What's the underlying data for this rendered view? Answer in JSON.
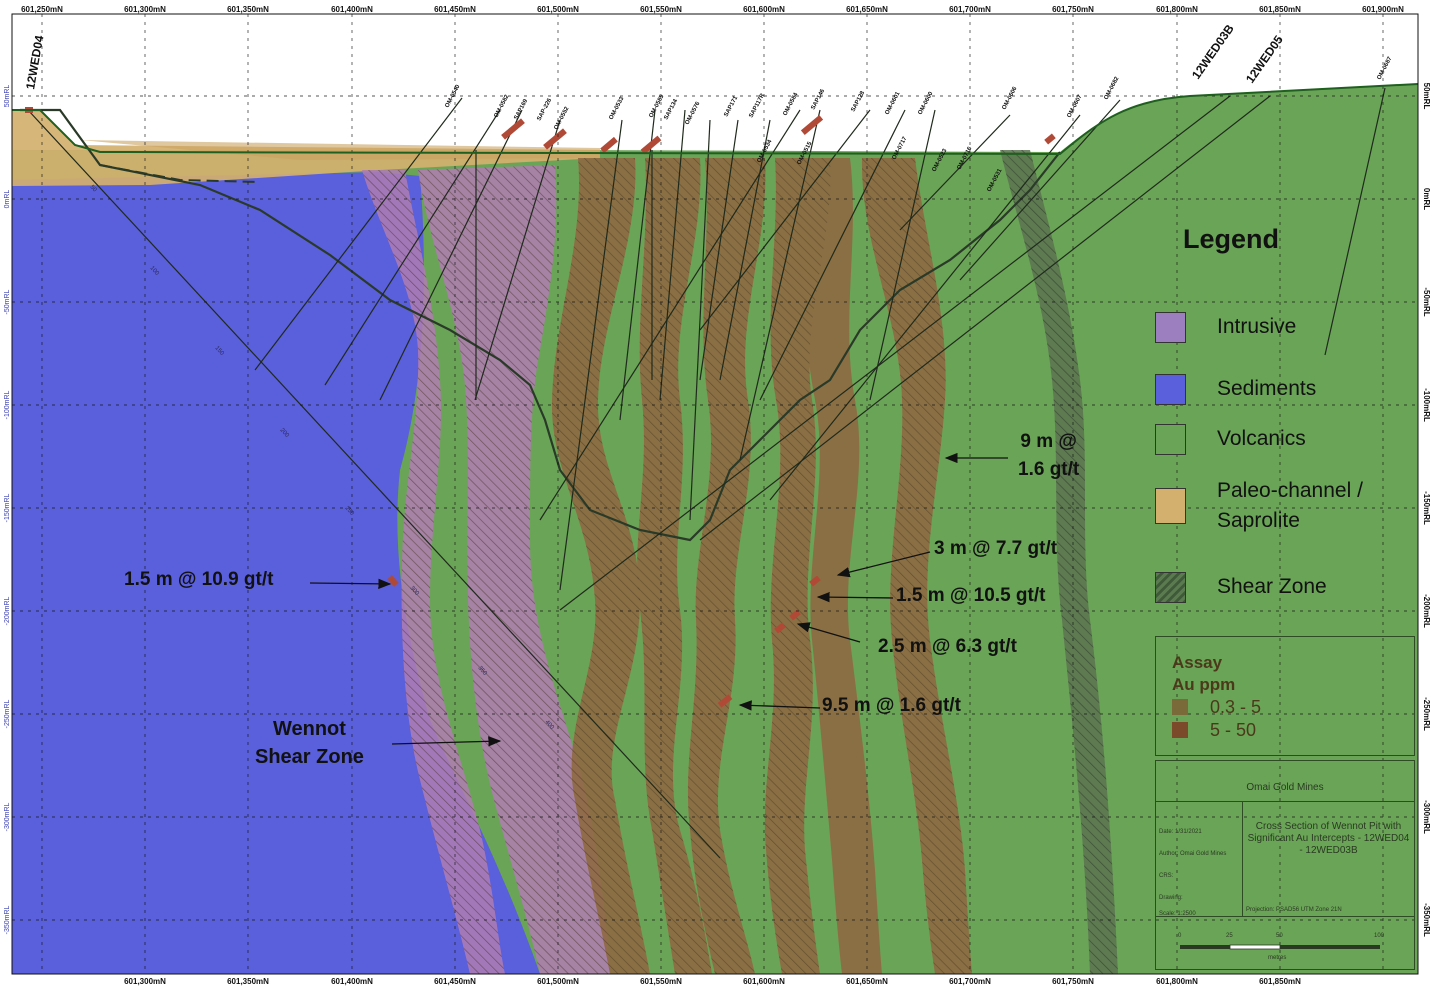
{
  "northing_labels": [
    "601,250mN",
    "601,300mN",
    "601,350mN",
    "601,400mN",
    "601,450mN",
    "601,500mN",
    "601,550mN",
    "601,600mN",
    "601,650mN",
    "601,700mN",
    "601,750mN",
    "601,800mN",
    "601,850mN",
    "601,900mN"
  ],
  "northing_bottom_labels": [
    "601,300mN",
    "601,350mN",
    "601,400mN",
    "601,450mN",
    "601,500mN",
    "601,550mN",
    "601,600mN",
    "601,650mN",
    "601,700mN",
    "601,750mN",
    "601,800mN",
    "601,850mN"
  ],
  "rl_labels": [
    "50mRL",
    "0mRL",
    "-50mRL",
    "-100mRL",
    "-150mRL",
    "-200mRL",
    "-250mRL",
    "-300mRL",
    "-350mRL"
  ],
  "holes": {
    "wed04": "12WED04",
    "wed03b": "12WED03B",
    "wed05": "12WED05",
    "minor": [
      "OM-0540",
      "OM-0582",
      "SAP169",
      "SAP-226",
      "OM-0552",
      "OM-0533",
      "OM-0585",
      "SAP134",
      "OM-0576",
      "SAP171",
      "SAP117R",
      "OM-0584",
      "SAP146",
      "SAP128",
      "OM-0601",
      "OM-0600",
      "OM-0606",
      "OM-0607",
      "OM-0682",
      "OM-0687",
      "OM-0534",
      "OM-0515",
      "OM-0717",
      "OM-0523",
      "OM-0716",
      "OM-0531"
    ]
  },
  "depth_marks": [
    "50",
    "100",
    "150",
    "200",
    "250",
    "300",
    "350",
    "400"
  ],
  "legend": {
    "title": "Legend",
    "intrusive": "Intrusive",
    "sediments": "Sediments",
    "volcanics": "Volcanics",
    "paleo_line1": "Paleo-channel /",
    "paleo_line2": "Saprolite",
    "shear": "Shear Zone",
    "colors": {
      "intrusive": "#9b7fbf",
      "sediments": "#5a5fdc",
      "volcanics": "#6aa457",
      "paleo": "#d4b06e"
    }
  },
  "assay": {
    "title_line1": "Assay",
    "title_line2": "Au ppm",
    "range1": "0.3 - 5",
    "range2": "5 - 50",
    "colors": {
      "range1": "#7a6a3a",
      "range2": "#7a4a2a"
    }
  },
  "title_block": {
    "company": "Omai Gold Mines",
    "rows": [
      "Date: 1/31/2021",
      "Author: Omai Gold Mines",
      "CRS:",
      "Drawing:",
      "Scale: 1:2500"
    ],
    "description": "Cross Section of Wennot Pit with Significant Au Intercepts - 12WED04 - 12WED03B",
    "projection": "Projection: PSAD56 UTM Zone 21N",
    "scale_ticks": [
      "0",
      "25",
      "50",
      "100"
    ],
    "scale_unit": "metres"
  },
  "annotations": {
    "i1_line1": "9 m @",
    "i1_line2": "1.6 gt/t",
    "i2": "3 m @ 7.7 gt/t",
    "i3": "1.5 m @ 10.5 gt/t",
    "i4": "2.5 m @ 6.3 gt/t",
    "i5": "9.5 m @ 1.6 gt/t",
    "i6": "1.5 m @ 10.9 gt/t",
    "wennot_line1": "Wennot",
    "wennot_line2": "Shear Zone"
  }
}
